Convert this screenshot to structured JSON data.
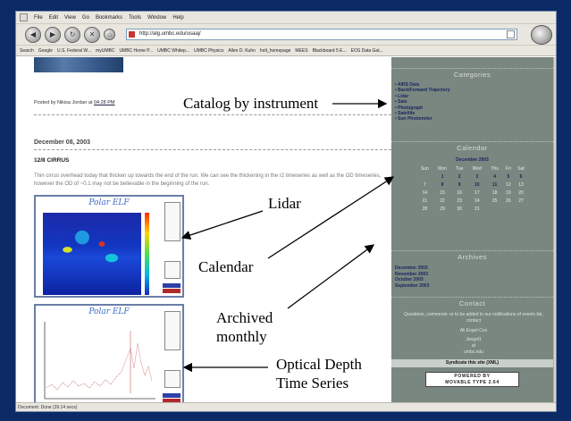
{
  "browser": {
    "menu": [
      "File",
      "Edit",
      "View",
      "Go",
      "Bookmarks",
      "Tools",
      "Window",
      "Help"
    ],
    "url": "http://alg.umbc.edu/usaaj/",
    "bookmarks": [
      "Search",
      "Google",
      "U.S. Federal W...",
      "myUMBC",
      "UMBC Home P...",
      "UMBC Whitep...",
      "UMBC Physics",
      "Allen D. Kuhn",
      "holt_homepage",
      "MEES",
      "Blackboard 5 E...",
      "EOS Data Gat..."
    ],
    "status": "Document: Done (39.14 secs)"
  },
  "blog": {
    "posted_prefix": "Posted by Nikisa Jordan at",
    "posted_time": "04:28 PM",
    "date": "December 08, 2003",
    "entry_title": "12/8 CIRRUS",
    "entry_body": "Thin cirrus overhead today that thicken up towards the end of the run. We can see the thickening in the r2 timeseries as well as the OD timeseries, however the OD of ~0.1 may not be believable in the beginning of the run.",
    "plot1_title": "Polar ELF",
    "plot2_title": "Polar ELF"
  },
  "sidebar": {
    "categories_heading": "Categories",
    "categories": [
      "AIRS Data",
      "Back/Forward Trajectory",
      "Lidar",
      "Sats",
      "Photograph",
      "Satellite",
      "Sun Photometer"
    ],
    "calendar_heading": "Calendar",
    "calendar_month": "December 2003",
    "weekdays": [
      "Sun",
      "Mon",
      "Tue",
      "Wed",
      "Thu",
      "Fri",
      "Sat"
    ],
    "weeks": [
      [
        "",
        "1",
        "2",
        "3",
        "4",
        "5",
        "6"
      ],
      [
        "7",
        "8",
        "9",
        "10",
        "11",
        "12",
        "13"
      ],
      [
        "14",
        "15",
        "16",
        "17",
        "18",
        "19",
        "20"
      ],
      [
        "21",
        "22",
        "23",
        "24",
        "25",
        "26",
        "27"
      ],
      [
        "28",
        "29",
        "30",
        "31",
        "",
        "",
        ""
      ]
    ],
    "archives_heading": "Archives",
    "archives": [
      "December 2003",
      "November 2003",
      "October 2003",
      "September 2003"
    ],
    "contact_heading": "Contact",
    "contact_text": "Questions, comments: or to be added to our notifications of events list, contact",
    "contact_name": "Ali Engel-Cox",
    "contact_email_1": "Jengel1",
    "contact_email_2": "at",
    "contact_email_3": "umbc.edu",
    "syndicate": "Syndicate this site (XML)",
    "powered_1": "POWERED BY",
    "powered_2": "MOVABLE TYPE 2.64"
  },
  "annotations": {
    "catalog": "Catalog by instrument",
    "lidar": "Lidar",
    "calendar": "Calendar",
    "archived_1": "Archived",
    "archived_2": "monthly",
    "optical_1": "Optical Depth",
    "optical_2": "Time Series"
  }
}
